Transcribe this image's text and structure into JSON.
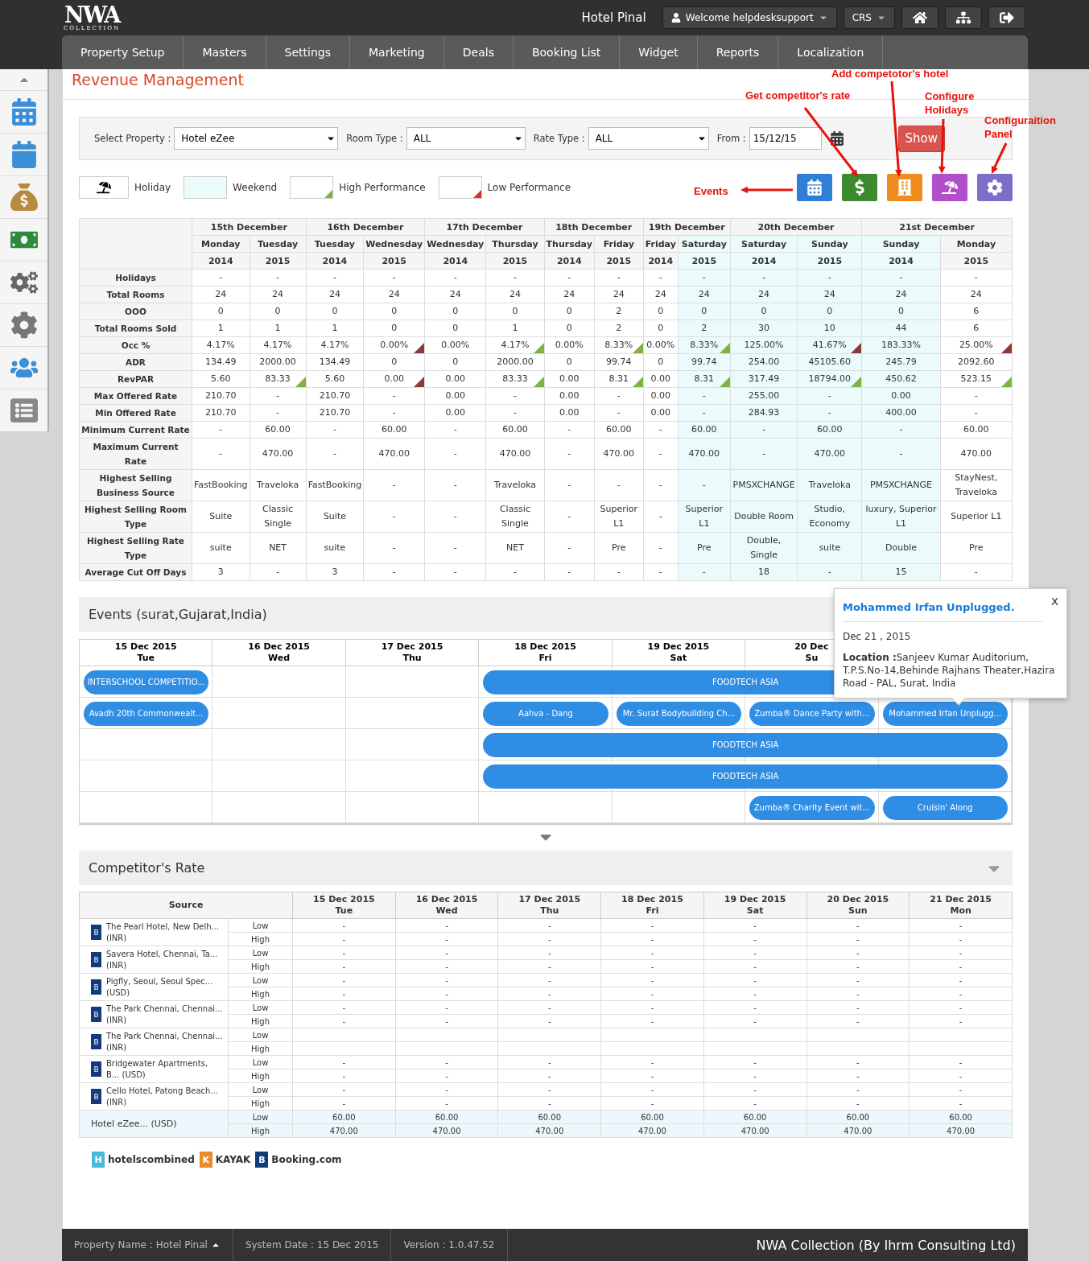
{
  "header": {
    "logo": {
      "mark": "NWA",
      "sub": "COLLECTION"
    },
    "hotel": "Hotel Pinal",
    "user_menu": "Welcome helpdesksupport",
    "crs_menu": "CRS"
  },
  "nav": [
    "Property Setup",
    "Masters",
    "Settings",
    "Marketing",
    "Deals",
    "Booking List",
    "Widget",
    "Reports",
    "Localization"
  ],
  "page_title": "Revenue Management",
  "filters": {
    "property": {
      "label": "Select Property :",
      "value": "Hotel eZee"
    },
    "room_type": {
      "label": "Room Type :",
      "value": "ALL"
    },
    "rate_type": {
      "label": "Rate Type :",
      "value": "ALL"
    },
    "from": {
      "label": "From :",
      "value": "15/12/15"
    },
    "show_button": "Show"
  },
  "legend": [
    {
      "label": "Holiday",
      "kind": "holiday"
    },
    {
      "label": "Weekend",
      "kind": "weekend"
    },
    {
      "label": "High Performance",
      "kind": "high"
    },
    {
      "label": "Low Performance",
      "kind": "low"
    }
  ],
  "annotations": [
    "Add competotor's hotel",
    "Get competitor's rate",
    "Configure Holidays",
    "Configuraition Panel",
    "Events"
  ],
  "revenue_table": {
    "dates": [
      "15th December",
      "16th December",
      "17th December",
      "18th December",
      "19th December",
      "20th December",
      "21st December"
    ],
    "columns": [
      {
        "day": "Monday",
        "year": "2014",
        "weekend": false
      },
      {
        "day": "Tuesday",
        "year": "2015",
        "weekend": false
      },
      {
        "day": "Tuesday",
        "year": "2014",
        "weekend": false
      },
      {
        "day": "Wednesday",
        "year": "2015",
        "weekend": false
      },
      {
        "day": "Wednesday",
        "year": "2014",
        "weekend": false
      },
      {
        "day": "Thursday",
        "year": "2015",
        "weekend": false
      },
      {
        "day": "Thursday",
        "year": "2014",
        "weekend": false
      },
      {
        "day": "Friday",
        "year": "2015",
        "weekend": false
      },
      {
        "day": "Friday",
        "year": "2014",
        "weekend": false
      },
      {
        "day": "Saturday",
        "year": "2015",
        "weekend": true
      },
      {
        "day": "Saturday",
        "year": "2014",
        "weekend": true
      },
      {
        "day": "Sunday",
        "year": "2015",
        "weekend": true
      },
      {
        "day": "Sunday",
        "year": "2014",
        "weekend": true
      },
      {
        "day": "Monday",
        "year": "2015",
        "weekend": false
      }
    ],
    "rows": [
      {
        "label": "Holidays",
        "cells": [
          "-",
          "-",
          "-",
          "-",
          "-",
          "-",
          "-",
          "-",
          "-",
          "-",
          "-",
          "-",
          "-",
          "-"
        ]
      },
      {
        "label": "Total Rooms",
        "cells": [
          "24",
          "24",
          "24",
          "24",
          "24",
          "24",
          "24",
          "24",
          "24",
          "24",
          "24",
          "24",
          "24",
          "24"
        ]
      },
      {
        "label": "OOO",
        "cells": [
          "0",
          "0",
          "0",
          "0",
          "0",
          "0",
          "0",
          "2",
          "0",
          "0",
          "0",
          "0",
          "0",
          "6"
        ]
      },
      {
        "label": "Total Rooms Sold",
        "cells": [
          "1",
          "1",
          "1",
          "0",
          "0",
          "1",
          "0",
          "2",
          "0",
          "2",
          "30",
          "10",
          "44",
          "6"
        ]
      },
      {
        "label": "Occ %",
        "cells": [
          {
            "value": "4.17%",
            "high_performance": false,
            "low_performance": false
          },
          {
            "value": "4.17%",
            "high_performance": false,
            "low_performance": false
          },
          {
            "value": "4.17%",
            "high_performance": false,
            "low_performance": false
          },
          {
            "value": "0.00%",
            "high_performance": false,
            "low_performance": true
          },
          {
            "value": "0.00%",
            "high_performance": false,
            "low_performance": false
          },
          {
            "value": "4.17%",
            "high_performance": true,
            "low_performance": false
          },
          {
            "value": "0.00%",
            "high_performance": false,
            "low_performance": false
          },
          {
            "value": "8.33%",
            "high_performance": true,
            "low_performance": false
          },
          {
            "value": "0.00%",
            "high_performance": false,
            "low_performance": false
          },
          {
            "value": "8.33%",
            "high_performance": true,
            "low_performance": false
          },
          {
            "value": "125.00%",
            "high_performance": false,
            "low_performance": false
          },
          {
            "value": "41.67%",
            "high_performance": false,
            "low_performance": true
          },
          {
            "value": "183.33%",
            "high_performance": false,
            "low_performance": false
          },
          {
            "value": "25.00%",
            "high_performance": false,
            "low_performance": true
          }
        ]
      },
      {
        "label": "ADR",
        "cells": [
          "134.49",
          "2000.00",
          "134.49",
          "0",
          "0",
          "2000.00",
          "0",
          "99.74",
          "0",
          "99.74",
          "254.00",
          "45105.60",
          "245.79",
          "2092.60"
        ]
      },
      {
        "label": "RevPAR",
        "cells": [
          {
            "value": "5.60",
            "high_performance": false,
            "low_performance": false
          },
          {
            "value": "83.33",
            "high_performance": true,
            "low_performance": false
          },
          {
            "value": "5.60",
            "high_performance": false,
            "low_performance": false
          },
          {
            "value": "0.00",
            "high_performance": false,
            "low_performance": true
          },
          {
            "value": "0.00",
            "high_performance": false,
            "low_performance": false
          },
          {
            "value": "83.33",
            "high_performance": true,
            "low_performance": false
          },
          {
            "value": "0.00",
            "high_performance": false,
            "low_performance": false
          },
          {
            "value": "8.31",
            "high_performance": true,
            "low_performance": false
          },
          {
            "value": "0.00",
            "high_performance": false,
            "low_performance": false
          },
          {
            "value": "8.31",
            "high_performance": true,
            "low_performance": false
          },
          {
            "value": "317.49",
            "high_performance": false,
            "low_performance": false
          },
          {
            "value": "18794.00",
            "high_performance": true,
            "low_performance": false
          },
          {
            "value": "450.62",
            "high_performance": false,
            "low_performance": false
          },
          {
            "value": "523.15",
            "high_performance": true,
            "low_performance": false
          }
        ]
      },
      {
        "label": "Max Offered Rate",
        "cells": [
          "210.70",
          "-",
          "210.70",
          "-",
          "0.00",
          "-",
          "0.00",
          "-",
          "0.00",
          "-",
          "255.00",
          "-",
          "0.00",
          "-"
        ]
      },
      {
        "label": "Min Offered Rate",
        "cells": [
          "210.70",
          "-",
          "210.70",
          "-",
          "0.00",
          "-",
          "0.00",
          "-",
          "0.00",
          "-",
          "284.93",
          "-",
          "400.00",
          "-"
        ]
      },
      {
        "label": "Minimum Current Rate",
        "cells": [
          "-",
          "60.00",
          "-",
          "60.00",
          "-",
          "60.00",
          "-",
          "60.00",
          "-",
          "60.00",
          "-",
          "60.00",
          "-",
          "60.00"
        ]
      },
      {
        "label": "Maximum Current Rate",
        "cells": [
          "-",
          "470.00",
          "-",
          "470.00",
          "-",
          "470.00",
          "-",
          "470.00",
          "-",
          "470.00",
          "-",
          "470.00",
          "-",
          "470.00"
        ]
      },
      {
        "label": "Highest Selling Business Source",
        "cells": [
          "FastBooking",
          "Traveloka",
          "FastBooking",
          "-",
          "-",
          "Traveloka",
          "-",
          "-",
          "-",
          "-",
          "PMSXCHANGE",
          "Traveloka",
          "PMSXCHANGE",
          "StayNest, Traveloka"
        ]
      },
      {
        "label": "Highest Selling Room Type",
        "cells": [
          "Suite",
          "Classic Single",
          "Suite",
          "-",
          "-",
          "Classic Single",
          "-",
          "Superior L1",
          "-",
          "Superior L1",
          "Double Room",
          "Studio, Economy",
          "luxury, Superior L1",
          "Superior L1"
        ]
      },
      {
        "label": "Highest Selling Rate Type",
        "cells": [
          "suite",
          "NET",
          "suite",
          "-",
          "-",
          "NET",
          "-",
          "Pre",
          "-",
          "Pre",
          "Double, Single",
          "suite",
          "Double",
          "Pre"
        ]
      },
      {
        "label": "Average Cut Off Days",
        "cells": [
          "3",
          "-",
          "3",
          "-",
          "-",
          "-",
          "-",
          "-",
          "-",
          "-",
          "18",
          "-",
          "15",
          "-"
        ]
      }
    ]
  },
  "events": {
    "title": "Events (surat,Gujarat,India)",
    "days": [
      {
        "date": "15 Dec 2015",
        "day": "Tue"
      },
      {
        "date": "16 Dec 2015",
        "day": "Wed"
      },
      {
        "date": "17 Dec 2015",
        "day": "Thu"
      },
      {
        "date": "18 Dec 2015",
        "day": "Fri"
      },
      {
        "date": "19 Dec 2015",
        "day": "Sat"
      },
      {
        "date": "20 Dec",
        "day": "Su"
      }
    ],
    "rows": [
      [
        "INTERSCHOOL COMPETITIO...",
        "",
        "",
        "FOODTECH ASIA"
      ],
      [
        "Avadh 20th Commonwealt...",
        "",
        "",
        "Aahva - Dang",
        "Mr. Surat Bodybuilding Ch...",
        "Zumba® Dance Party with...",
        "Mohammed Irfan Unplugg..."
      ],
      [
        "",
        "",
        "",
        "FOODTECH ASIA"
      ],
      [
        "",
        "",
        "",
        "FOODTECH ASIA"
      ],
      [
        "",
        "",
        "",
        "",
        "",
        "Zumba® Charity Event wit...",
        "Cruisin' Along"
      ]
    ],
    "popup": {
      "title": "Mohammed Irfan Unplugged.",
      "close": "X",
      "date": "Dec 21 , 2015",
      "location": "**Location :**Sanjeev Kumar Auditorium, T.P.S.No-14,Behinde Rajhans Theater,Hazira Road - PAL, Surat, India"
    }
  },
  "competitors": {
    "title": "Competitor's Rate",
    "source_heading": "Source",
    "days": [
      {
        "date": "15 Dec 2015",
        "day": "Tue"
      },
      {
        "date": "16 Dec 2015",
        "day": "Wed"
      },
      {
        "date": "17 Dec 2015",
        "day": "Thu"
      },
      {
        "date": "18 Dec 2015",
        "day": "Fri"
      },
      {
        "date": "19 Dec 2015",
        "day": "Sat"
      },
      {
        "date": "20 Dec 2015",
        "day": "Sun"
      },
      {
        "date": "21 Dec 2015",
        "day": "Mon"
      }
    ],
    "rows": [
      {
        "kind": "competitor",
        "badge": "B",
        "name": "The Pearl Hotel, New Delh...",
        "currency": "(INR)",
        "rates": [
          {
            "label": "Low",
            "values": [
              "-",
              "-",
              "-",
              "-",
              "-",
              "-",
              "-"
            ]
          },
          {
            "label": "High",
            "values": [
              "-",
              "-",
              "-",
              "-",
              "-",
              "-",
              "-"
            ]
          }
        ]
      },
      {
        "kind": "competitor",
        "badge": "B",
        "name": "Savera Hotel, Chennai, Ta...",
        "currency": "(INR)",
        "rates": [
          {
            "label": "Low",
            "values": [
              "-",
              "-",
              "-",
              "-",
              "-",
              "-",
              "-"
            ]
          },
          {
            "label": "High",
            "values": [
              "-",
              "-",
              "-",
              "-",
              "-",
              "-",
              "-"
            ]
          }
        ]
      },
      {
        "kind": "competitor",
        "badge": "B",
        "name": "Pigfly, Seoul, Seoul Spec...",
        "currency": "(USD)",
        "rates": [
          {
            "label": "Low",
            "values": [
              "-",
              "-",
              "-",
              "-",
              "-",
              "-",
              "-"
            ]
          },
          {
            "label": "High",
            "values": [
              "-",
              "-",
              "-",
              "-",
              "-",
              "-",
              "-"
            ]
          }
        ]
      },
      {
        "kind": "competitor",
        "badge": "B",
        "name": "The Park Chennai, Chennai...",
        "currency": "(INR)",
        "rates": [
          {
            "label": "Low",
            "values": [
              "-",
              "-",
              "-",
              "-",
              "-",
              "-",
              "-"
            ]
          },
          {
            "label": "High",
            "values": [
              "-",
              "-",
              "-",
              "-",
              "-",
              "-",
              "-"
            ]
          }
        ]
      },
      {
        "kind": "competitor",
        "badge": "B",
        "name": "The Park Chennai, Chennai...",
        "currency": "(INR)",
        "rates": [
          {
            "label": "Low"
          },
          {
            "label": "High"
          }
        ]
      },
      {
        "kind": "competitor",
        "badge": "B",
        "name": "Bridgewater Apartments, B...",
        "currency": "(USD)",
        "rates": [
          {
            "label": "Low",
            "values": [
              "-",
              "-",
              "-",
              "-",
              "-",
              "-",
              "-"
            ]
          },
          {
            "label": "High",
            "values": [
              "-",
              "-",
              "-",
              "-",
              "-",
              "-",
              "-"
            ]
          }
        ]
      },
      {
        "kind": "competitor",
        "badge": "B",
        "name": "Cello Hotel, Patong Beach...",
        "currency": "(INR)",
        "rates": [
          {
            "label": "Low",
            "values": [
              "-",
              "-",
              "-",
              "-",
              "-",
              "-",
              "-"
            ]
          },
          {
            "label": "High",
            "values": [
              "-",
              "-",
              "-",
              "-",
              "-",
              "-",
              "-"
            ]
          }
        ]
      },
      {
        "kind": "own",
        "name": "Hotel eZee...",
        "currency": "(USD)",
        "rates": [
          {
            "label": "Low",
            "values": [
              "60.00",
              "60.00",
              "60.00",
              "60.00",
              "60.00",
              "60.00",
              "60.00"
            ]
          },
          {
            "label": "High",
            "values": [
              "470.00",
              "470.00",
              "470.00",
              "470.00",
              "470.00",
              "470.00",
              "470.00"
            ]
          }
        ]
      }
    ],
    "sources": [
      {
        "badge": "H",
        "name": "hotelscombined",
        "color": "#4cb8d9"
      },
      {
        "badge": "K",
        "name": "KAYAK",
        "color": "#ea8a2c"
      },
      {
        "badge": "B",
        "name": "Booking.com",
        "color": "#123b7d"
      }
    ]
  },
  "footer": {
    "property": "Property Name : Hotel Pinal",
    "system_date": "System Date : 15 Dec 2015",
    "version": "Version : 1.0.47.52",
    "company": "NWA Collection (By Ihrm Consulting Ltd)"
  }
}
